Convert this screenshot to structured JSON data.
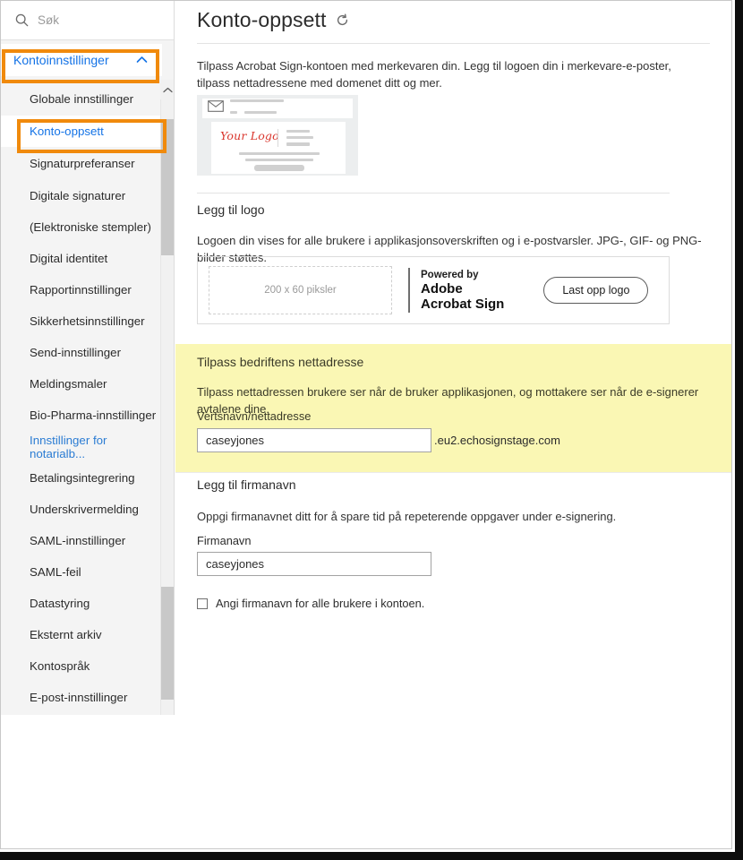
{
  "sidebar": {
    "search": {
      "placeholder": "Søk",
      "icon": "search-icon"
    },
    "group": {
      "label": "Kontoinnstillinger",
      "chevron": "chevron-up-icon"
    },
    "items": [
      {
        "label": "Globale innstillinger",
        "state": "normal"
      },
      {
        "label": "Konto-oppsett",
        "state": "selected"
      },
      {
        "label": "Signaturpreferanser",
        "state": "normal"
      },
      {
        "label": "Digitale signaturer",
        "state": "normal"
      },
      {
        "label": "(Elektroniske stempler)",
        "state": "normal"
      },
      {
        "label": "Digital identitet",
        "state": "normal"
      },
      {
        "label": "Rapportinnstillinger",
        "state": "normal"
      },
      {
        "label": "Sikkerhetsinnstillinger",
        "state": "normal"
      },
      {
        "label": "Send-innstillinger",
        "state": "normal"
      },
      {
        "label": "Meldingsmaler",
        "state": "normal"
      },
      {
        "label": "Bio-Pharma-innstillinger",
        "state": "normal"
      },
      {
        "label": "Innstillinger for notarialb...",
        "state": "link"
      },
      {
        "label": "Betalingsintegrering",
        "state": "normal"
      },
      {
        "label": "Underskrivermelding",
        "state": "normal"
      },
      {
        "label": "SAML-innstillinger",
        "state": "normal"
      },
      {
        "label": "SAML-feil",
        "state": "normal"
      },
      {
        "label": "Datastyring",
        "state": "normal"
      },
      {
        "label": "Eksternt arkiv",
        "state": "normal"
      },
      {
        "label": "Kontospråk",
        "state": "normal"
      },
      {
        "label": "E-post-innstillinger",
        "state": "normal"
      }
    ]
  },
  "annotations": {
    "color": "#f08a0c",
    "boxes": [
      {
        "target": "Kontoinnstillinger"
      },
      {
        "target": "Konto-oppsett"
      }
    ]
  },
  "main": {
    "title": "Konto-oppsett",
    "refresh_icon": "refresh-icon",
    "intro": "Tilpass Acrobat Sign-kontoen med merkevaren din. Legg til logoen din i merkevare-e-poster, tilpass nettadressene med domenet ditt og mer.",
    "email_preview": {
      "envelope_icon": "envelope-icon",
      "logo_text": "Your Logo"
    },
    "add_logo": {
      "heading": "Legg til logo",
      "description": "Logoen din vises for alle brukere i applikasjonsoverskriften og i e-postvarsler. JPG-, GIF- og PNG-bilder støttes.",
      "dropzone_text": "200 x 60 piksler",
      "powered_by": "Powered by",
      "brand_line1": "Adobe",
      "brand_line2": "Acrobat Sign",
      "upload_button": "Last opp logo"
    },
    "custom_url": {
      "highlight_color": "#faf7b4",
      "heading": "Tilpass bedriftens nettadresse",
      "description": "Tilpass nettadressen brukere ser når de bruker applikasjonen, og mottakere ser når de e-signerer avtalene dine.",
      "field_label": "Vertsnavn/nettadresse",
      "field_value": "caseyjones",
      "field_placeholder": "",
      "suffix": ".eu2.echosignstage.com"
    },
    "company_name": {
      "heading": "Legg til firmanavn",
      "description": "Oppgi firmanavnet ditt for å spare tid på repeterende oppgaver under e-signering.",
      "field_label": "Firmanavn",
      "field_value": "caseyjones",
      "field_placeholder": "",
      "checkbox_label": "Angi firmanavn for alle brukere i kontoen.",
      "checkbox_checked": false
    }
  }
}
